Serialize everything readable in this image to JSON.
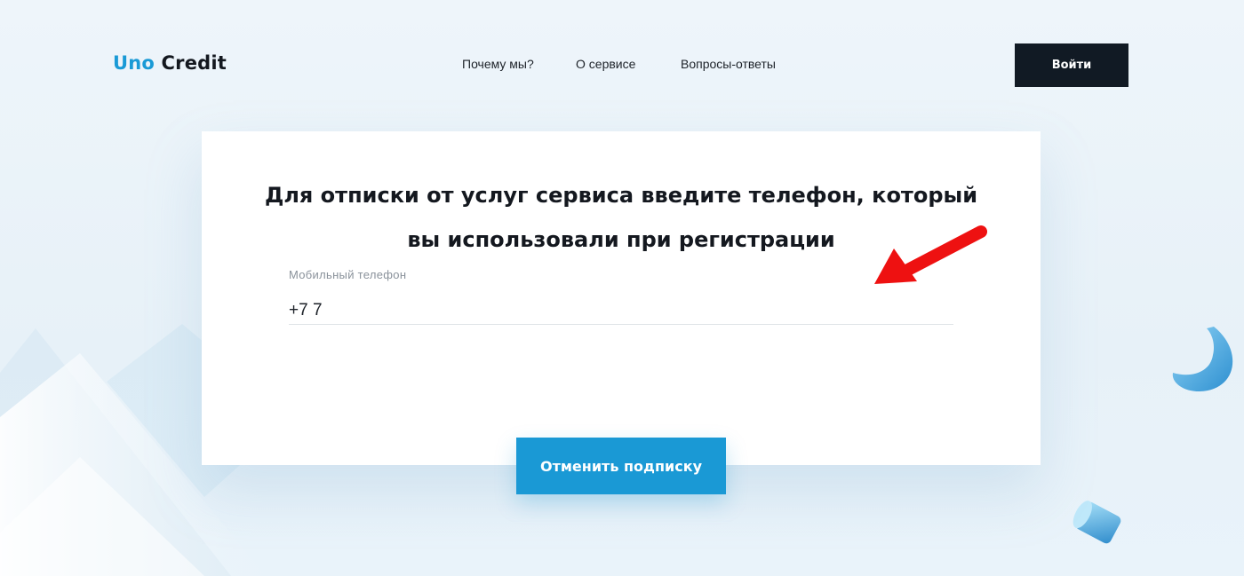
{
  "brand": {
    "part1": "Uno",
    "part2": "Credit",
    "accent_color": "#1a9ad6",
    "dark_color": "#14181f"
  },
  "nav": {
    "items": [
      {
        "label": "Почему мы?"
      },
      {
        "label": "О сервисе"
      },
      {
        "label": "Вопросы-ответы"
      }
    ]
  },
  "header": {
    "login_label": "Войти"
  },
  "form": {
    "title_line1": "Для отписки от услуг сервиса введите телефон, который",
    "title_line2": "вы использовали при регистрации",
    "phone_label": "Мобильный телефон",
    "phone_value": "+7 7",
    "submit_label": "Отменить подписку",
    "submit_color": "#1a99d5"
  },
  "annotation": {
    "icon": "red-arrow-icon",
    "color": "#ee1111"
  }
}
